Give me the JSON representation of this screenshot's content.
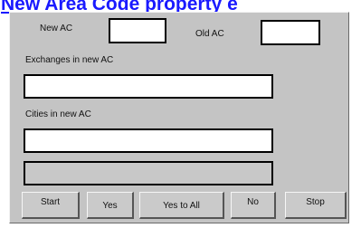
{
  "heading": "New Area Code property e",
  "form": {
    "new_ac_label": "New AC",
    "new_ac_value": "",
    "old_ac_label": "Old AC",
    "old_ac_value": "",
    "exchanges_label": "Exchanges in new AC",
    "exchanges_value": "",
    "cities_label": "Cities in new AC",
    "cities_value": "",
    "status_value": ""
  },
  "buttons": {
    "start": "Start",
    "yes": "Yes",
    "yes_to_all": "Yes to All",
    "no": "No",
    "stop": "Stop"
  }
}
